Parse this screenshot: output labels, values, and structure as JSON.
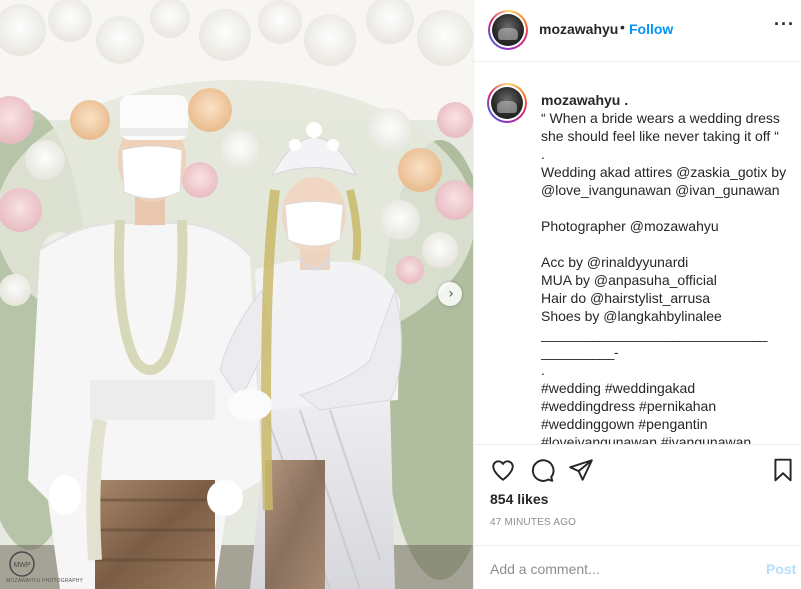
{
  "post": {
    "username": "mozawahyu",
    "separator": "•",
    "follow_label": "Follow",
    "more_icon": "more-horizontal-icon"
  },
  "photo": {
    "watermark_logo": "MWP",
    "watermark_text": "MOZAWAHYU PHOTOGRAPHY",
    "next_icon": "chevron-right-icon"
  },
  "caption": {
    "username": "mozawahyu .",
    "lines": [
      "“ When a bride wears a wedding dress",
      "she should feel like never taking it off “",
      ".",
      "Wedding akad attires @zaskia_gotix by",
      "@love_ivangunawan @ivan_gunawan",
      "",
      "Photographer @mozawahyu",
      "",
      "Acc by @rinaldyyunardi",
      "MUA by @anpasuha_official",
      "Hair do @hairstylist_arrusa",
      "Shoes by @langkahbylinalee",
      "_______________________________",
      "__________-",
      ".",
      "#wedding #weddingakad",
      "#weddingdress #pernikahan",
      "#weddinggown #pengantin",
      "#loveivangunawan #ivangunawan"
    ]
  },
  "actions": {
    "like_icon": "heart-icon",
    "comment_icon": "comment-icon",
    "share_icon": "paper-plane-icon",
    "save_icon": "bookmark-icon",
    "likes_text": "854 likes",
    "time_text": "47 MINUTES AGO"
  },
  "add_comment": {
    "placeholder": "Add a comment...",
    "post_label": "Post"
  },
  "colors": {
    "accent": "#0095f6",
    "post_disabled": "#b2dffc",
    "muted": "#8e8e8e",
    "text": "#262626",
    "border": "#efefef"
  }
}
